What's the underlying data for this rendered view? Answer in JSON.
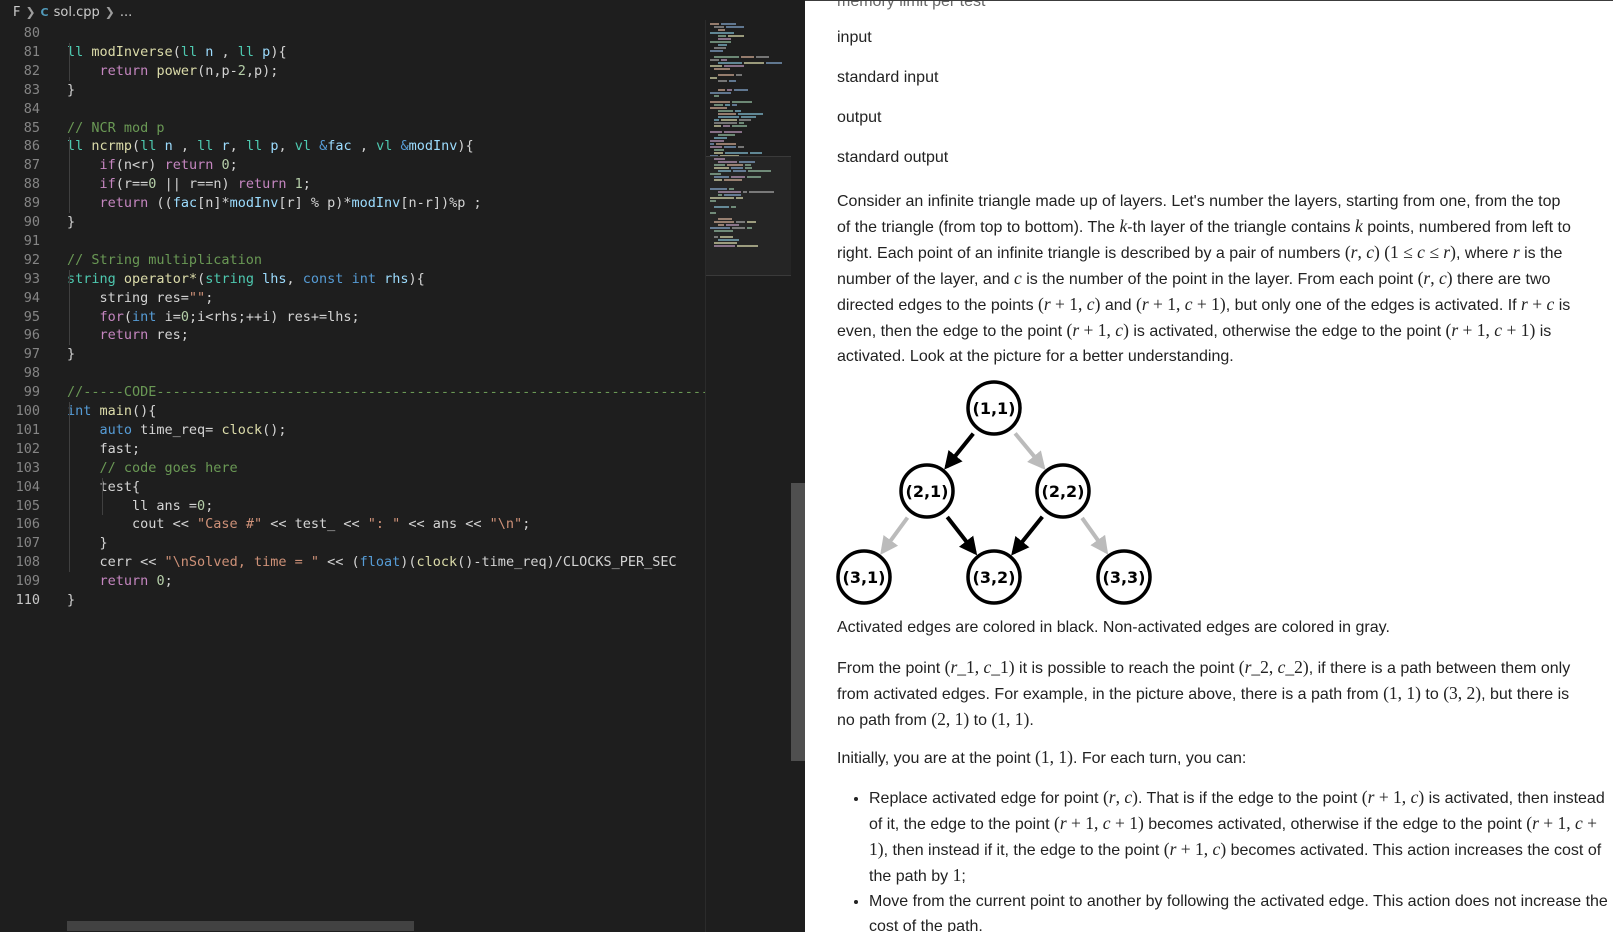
{
  "breadcrumb": {
    "root": "F",
    "file_icon": "C",
    "file": "sol.cpp",
    "more": "..."
  },
  "editor": {
    "current_line": 110,
    "lines": [
      {
        "n": "80",
        "tokens": []
      },
      {
        "n": "81",
        "tokens": [
          [
            "t",
            "ll"
          ],
          [
            "p",
            " "
          ],
          [
            "f",
            "modInverse"
          ],
          [
            "p",
            "("
          ],
          [
            "t",
            "ll"
          ],
          [
            "p",
            " "
          ],
          [
            "v",
            "n"
          ],
          [
            "p",
            " , "
          ],
          [
            "t",
            "ll"
          ],
          [
            "p",
            " "
          ],
          [
            "v",
            "p"
          ],
          [
            "p",
            "){"
          ]
        ]
      },
      {
        "n": "82",
        "tokens": [
          [
            "p",
            "    "
          ],
          [
            "c",
            "return"
          ],
          [
            "p",
            " "
          ],
          [
            "f",
            "power"
          ],
          [
            "p",
            "(n,p-"
          ],
          [
            "n",
            "2"
          ],
          [
            "p",
            ",p);"
          ]
        ]
      },
      {
        "n": "83",
        "tokens": [
          [
            "p",
            "}"
          ]
        ]
      },
      {
        "n": "84",
        "tokens": []
      },
      {
        "n": "85",
        "tokens": [
          [
            "cm",
            "// NCR mod p"
          ]
        ]
      },
      {
        "n": "86",
        "tokens": [
          [
            "t",
            "ll"
          ],
          [
            "p",
            " "
          ],
          [
            "f",
            "ncrmp"
          ],
          [
            "p",
            "("
          ],
          [
            "t",
            "ll"
          ],
          [
            "p",
            " "
          ],
          [
            "v",
            "n"
          ],
          [
            "p",
            " , "
          ],
          [
            "t",
            "ll"
          ],
          [
            "p",
            " "
          ],
          [
            "v",
            "r"
          ],
          [
            "p",
            ", "
          ],
          [
            "t",
            "ll"
          ],
          [
            "p",
            " "
          ],
          [
            "v",
            "p"
          ],
          [
            "p",
            ", "
          ],
          [
            "t",
            "vl"
          ],
          [
            "p",
            " "
          ],
          [
            "k",
            "&"
          ],
          [
            "v",
            "fac"
          ],
          [
            "p",
            " , "
          ],
          [
            "t",
            "vl"
          ],
          [
            "p",
            " "
          ],
          [
            "k",
            "&"
          ],
          [
            "v",
            "modInv"
          ],
          [
            "p",
            "){"
          ]
        ]
      },
      {
        "n": "87",
        "tokens": [
          [
            "p",
            "    "
          ],
          [
            "c",
            "if"
          ],
          [
            "p",
            "(n<r) "
          ],
          [
            "c",
            "return"
          ],
          [
            "p",
            " "
          ],
          [
            "n",
            "0"
          ],
          [
            "p",
            ";"
          ]
        ]
      },
      {
        "n": "88",
        "tokens": [
          [
            "p",
            "    "
          ],
          [
            "c",
            "if"
          ],
          [
            "p",
            "(r=="
          ],
          [
            "n",
            "0"
          ],
          [
            "p",
            " || r==n) "
          ],
          [
            "c",
            "return"
          ],
          [
            "p",
            " "
          ],
          [
            "n",
            "1"
          ],
          [
            "p",
            ";"
          ]
        ]
      },
      {
        "n": "89",
        "tokens": [
          [
            "p",
            "    "
          ],
          [
            "c",
            "return"
          ],
          [
            "p",
            " (("
          ],
          [
            "v",
            "fac"
          ],
          [
            "p",
            "[n]*"
          ],
          [
            "v",
            "modInv"
          ],
          [
            "p",
            "[r] % p)*"
          ],
          [
            "v",
            "modInv"
          ],
          [
            "p",
            "[n-r])%p ;"
          ]
        ]
      },
      {
        "n": "90",
        "tokens": [
          [
            "p",
            "}"
          ]
        ]
      },
      {
        "n": "91",
        "tokens": []
      },
      {
        "n": "92",
        "tokens": [
          [
            "cm",
            "// String multiplication"
          ]
        ]
      },
      {
        "n": "93",
        "tokens": [
          [
            "t",
            "string"
          ],
          [
            "p",
            " "
          ],
          [
            "f",
            "operator*"
          ],
          [
            "p",
            "("
          ],
          [
            "t",
            "string"
          ],
          [
            "p",
            " "
          ],
          [
            "v",
            "lhs"
          ],
          [
            "p",
            ", "
          ],
          [
            "k",
            "const"
          ],
          [
            "p",
            " "
          ],
          [
            "k",
            "int"
          ],
          [
            "p",
            " "
          ],
          [
            "v",
            "rhs"
          ],
          [
            "p",
            "){"
          ]
        ]
      },
      {
        "n": "94",
        "tokens": [
          [
            "p",
            "    string res="
          ],
          [
            "s",
            "\"\""
          ],
          [
            "p",
            ";"
          ]
        ]
      },
      {
        "n": "95",
        "tokens": [
          [
            "p",
            "    "
          ],
          [
            "c",
            "for"
          ],
          [
            "p",
            "("
          ],
          [
            "k",
            "int"
          ],
          [
            "p",
            " i="
          ],
          [
            "n",
            "0"
          ],
          [
            "p",
            ";i<rhs;++i) res+=lhs;"
          ]
        ]
      },
      {
        "n": "96",
        "tokens": [
          [
            "p",
            "    "
          ],
          [
            "c",
            "return"
          ],
          [
            "p",
            " res;"
          ]
        ]
      },
      {
        "n": "97",
        "tokens": [
          [
            "p",
            "}"
          ]
        ]
      },
      {
        "n": "98",
        "tokens": []
      },
      {
        "n": "99",
        "tokens": [
          [
            "cm",
            "//-----CODE--------------------------------------------------------------------"
          ]
        ]
      },
      {
        "n": "100",
        "tokens": [
          [
            "k",
            "int"
          ],
          [
            "p",
            " "
          ],
          [
            "f",
            "main"
          ],
          [
            "p",
            "(){"
          ]
        ]
      },
      {
        "n": "101",
        "tokens": [
          [
            "p",
            "    "
          ],
          [
            "k",
            "auto"
          ],
          [
            "p",
            " time_req= "
          ],
          [
            "f",
            "clock"
          ],
          [
            "p",
            "();"
          ]
        ]
      },
      {
        "n": "102",
        "tokens": [
          [
            "p",
            "    fast;"
          ]
        ]
      },
      {
        "n": "103",
        "tokens": [
          [
            "p",
            "    "
          ],
          [
            "cm",
            "// code goes here"
          ]
        ]
      },
      {
        "n": "104",
        "tokens": [
          [
            "p",
            "    test{"
          ]
        ]
      },
      {
        "n": "105",
        "tokens": [
          [
            "p",
            "        ll ans ="
          ],
          [
            "n",
            "0"
          ],
          [
            "p",
            ";"
          ]
        ]
      },
      {
        "n": "106",
        "tokens": [
          [
            "p",
            "        cout << "
          ],
          [
            "s",
            "\"Case #\""
          ],
          [
            "p",
            " << test_ << "
          ],
          [
            "s",
            "\": \""
          ],
          [
            "p",
            " << ans << "
          ],
          [
            "s",
            "\"\\n\""
          ],
          [
            "p",
            ";"
          ]
        ]
      },
      {
        "n": "107",
        "tokens": [
          [
            "p",
            "    }"
          ]
        ]
      },
      {
        "n": "108",
        "tokens": [
          [
            "p",
            "    cerr << "
          ],
          [
            "s",
            "\"\\nSolved, time = \""
          ],
          [
            "p",
            " << ("
          ],
          [
            "k",
            "float"
          ],
          [
            "p",
            ")("
          ],
          [
            "f",
            "clock"
          ],
          [
            "p",
            "()-time_req)/CLOCKS_PER_SEC"
          ]
        ]
      },
      {
        "n": "109",
        "tokens": [
          [
            "p",
            "    "
          ],
          [
            "c",
            "return"
          ],
          [
            "p",
            " "
          ],
          [
            "n",
            "0"
          ],
          [
            "p",
            ";"
          ]
        ]
      },
      {
        "n": "110",
        "tokens": [
          [
            "p",
            "}"
          ]
        ]
      }
    ]
  },
  "problem": {
    "input_label": "input",
    "input_value": "standard input",
    "output_label": "output",
    "output_value": "standard output",
    "figure": {
      "nodes": [
        "(1,1)",
        "(2,1)",
        "(2,2)",
        "(3,1)",
        "(3,2)",
        "(3,3)"
      ],
      "edges": [
        {
          "from": "(1,1)",
          "to": "(2,1)",
          "activated": true
        },
        {
          "from": "(1,1)",
          "to": "(2,2)",
          "activated": false
        },
        {
          "from": "(2,1)",
          "to": "(3,1)",
          "activated": false
        },
        {
          "from": "(2,1)",
          "to": "(3,2)",
          "activated": true
        },
        {
          "from": "(2,2)",
          "to": "(3,2)",
          "activated": true
        },
        {
          "from": "(2,2)",
          "to": "(3,3)",
          "activated": false
        }
      ],
      "colors": {
        "activated": "#000000",
        "non_activated": "#bbbbbb"
      }
    },
    "caption": "Activated edges are colored in black. Non-activated edges are colored in gray."
  },
  "colors": {
    "editor_bg": "#1e1e1e",
    "problem_bg": "#ffffff",
    "text": "#222222"
  }
}
